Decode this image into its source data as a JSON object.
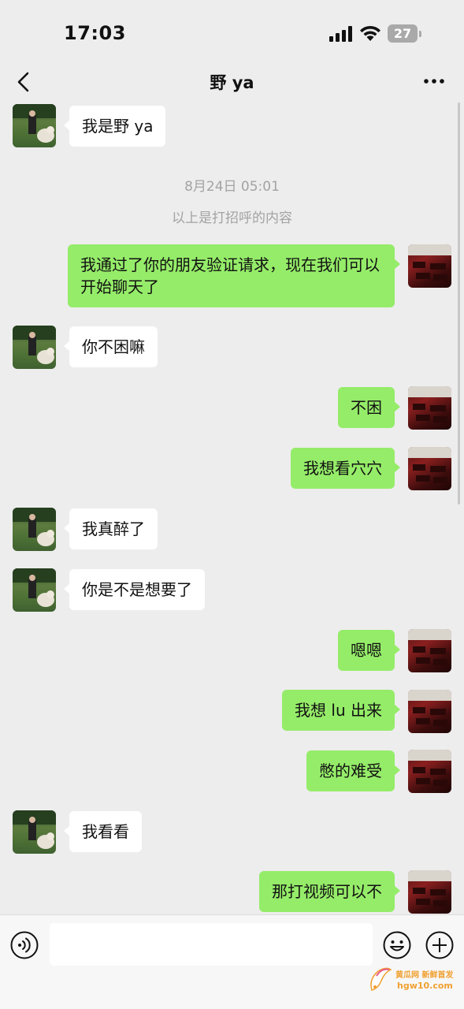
{
  "status_bar": {
    "time": "17:03",
    "battery_level": "27",
    "signal_icon": "cellular-signal-icon",
    "wifi_icon": "wifi-icon",
    "battery_icon": "battery-icon"
  },
  "nav": {
    "title": "野 ya",
    "back_icon": "chevron-left-icon",
    "more_icon": "more-dots-icon"
  },
  "messages": [
    {
      "side": "left",
      "text": "我是野 ya"
    },
    {
      "type": "timestamp",
      "text": "8月24日 05:01"
    },
    {
      "type": "system",
      "text": "以上是打招呼的内容"
    },
    {
      "side": "right",
      "text": "我通过了你的朋友验证请求，现在我们可以开始聊天了"
    },
    {
      "side": "left",
      "text": "你不困嘛"
    },
    {
      "side": "right",
      "text": "不困"
    },
    {
      "side": "right",
      "text": "我想看穴穴"
    },
    {
      "side": "left",
      "text": "我真醉了"
    },
    {
      "side": "left",
      "text": "你是不是想要了"
    },
    {
      "side": "right",
      "text": "嗯嗯"
    },
    {
      "side": "right",
      "text": "我想 lu 出来"
    },
    {
      "side": "right",
      "text": "憋的难受"
    },
    {
      "side": "left",
      "text": "我看看"
    },
    {
      "side": "right",
      "text": "那打视频可以不"
    }
  ],
  "input_bar": {
    "placeholder": "",
    "voice_icon": "voice-input-icon",
    "emoji_icon": "emoji-icon",
    "add_icon": "plus-circle-icon"
  },
  "watermark": {
    "line1": "黄瓜网  新鲜首发",
    "line2": "hgw10.com"
  },
  "colors": {
    "background": "#ededed",
    "sent_bubble": "#95ec69",
    "received_bubble": "#ffffff",
    "timestamp_text": "#a3a3a3",
    "watermark": "#f0a030"
  }
}
